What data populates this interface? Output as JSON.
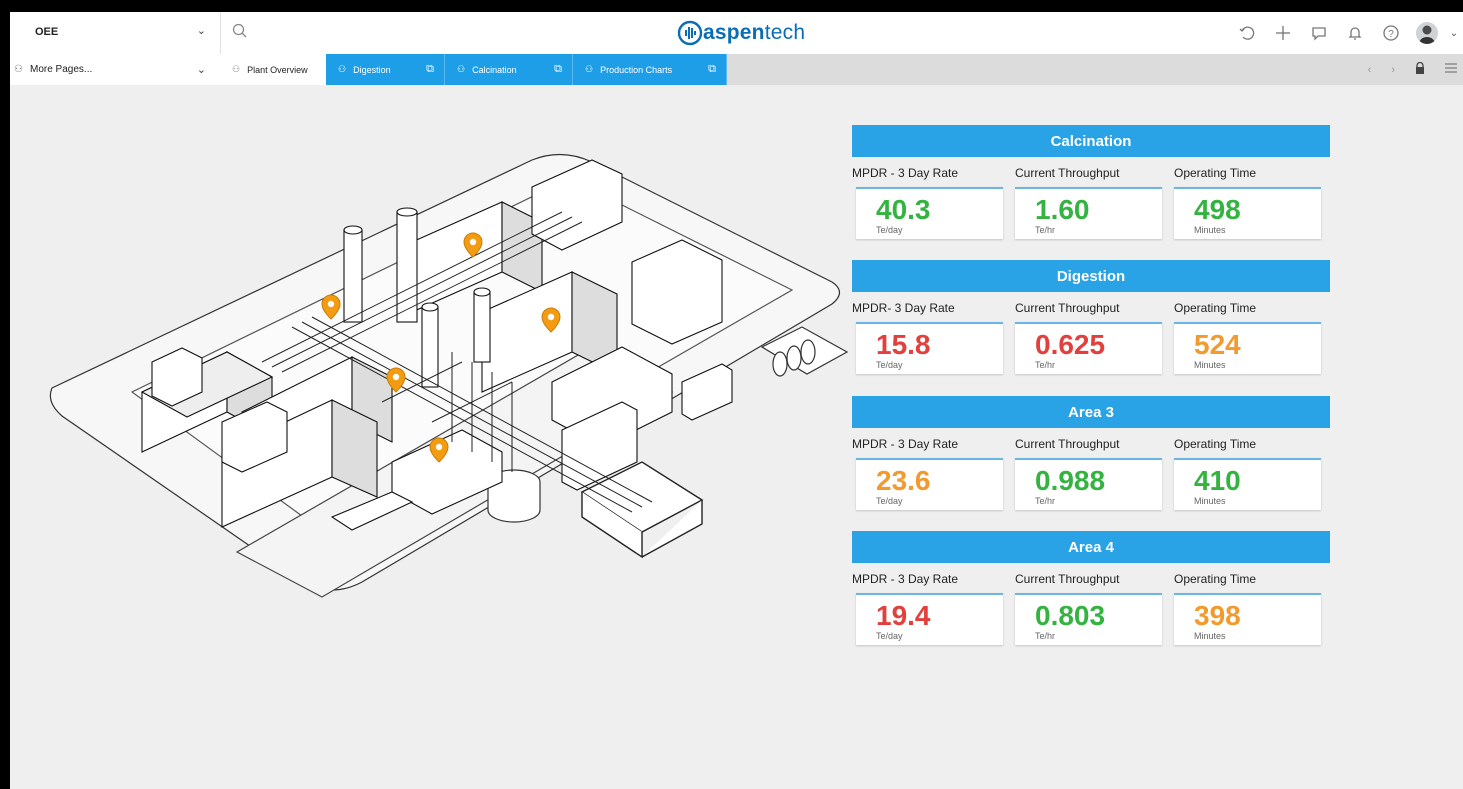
{
  "header": {
    "workspace": "OEE",
    "logo_prefix": "aspen",
    "logo_suffix": "tech",
    "icons": [
      "history-icon",
      "add-icon",
      "chat-icon",
      "bell-icon",
      "help-icon",
      "user-avatar"
    ]
  },
  "nav": {
    "more_pages": "More Pages...",
    "tabs": [
      {
        "label": "Plant Overview",
        "active": false
      },
      {
        "label": "Digestion",
        "active": true
      },
      {
        "label": "Calcination",
        "active": true
      },
      {
        "label": "Production Charts",
        "active": true
      }
    ]
  },
  "colors": {
    "good": "#34b341",
    "bad": "#e3403d",
    "warn": "#f29a2e",
    "accent": "#2aa3e6"
  },
  "panels": [
    {
      "title": "Calcination",
      "labels": [
        "MPDR - 3 Day Rate",
        "Current Throughput",
        "Operating Time"
      ],
      "metrics": [
        {
          "value": "40.3",
          "unit": "Te/day",
          "status": "good"
        },
        {
          "value": "1.60",
          "unit": "Te/hr",
          "status": "good"
        },
        {
          "value": "498",
          "unit": "Minutes",
          "status": "good"
        }
      ]
    },
    {
      "title": "Digestion",
      "labels": [
        "MPDR- 3 Day Rate",
        "Current Throughput",
        "Operating Time"
      ],
      "metrics": [
        {
          "value": "15.8",
          "unit": "Te/day",
          "status": "bad"
        },
        {
          "value": "0.625",
          "unit": "Te/hr",
          "status": "bad"
        },
        {
          "value": "524",
          "unit": "Minutes",
          "status": "warn"
        }
      ]
    },
    {
      "title": "Area 3",
      "labels": [
        "MPDR - 3 Day Rate",
        "Current Throughput",
        "Operating Time"
      ],
      "metrics": [
        {
          "value": "23.6",
          "unit": "Te/day",
          "status": "warn"
        },
        {
          "value": "0.988",
          "unit": "Te/hr",
          "status": "good"
        },
        {
          "value": "410",
          "unit": "Minutes",
          "status": "good"
        }
      ]
    },
    {
      "title": "Area 4",
      "labels": [
        "MPDR - 3 Day Rate",
        "Current Throughput",
        "Operating Time"
      ],
      "metrics": [
        {
          "value": "19.4",
          "unit": "Te/day",
          "status": "bad"
        },
        {
          "value": "0.803",
          "unit": "Te/hr",
          "status": "good"
        },
        {
          "value": "398",
          "unit": "Minutes",
          "status": "warn"
        }
      ]
    }
  ]
}
